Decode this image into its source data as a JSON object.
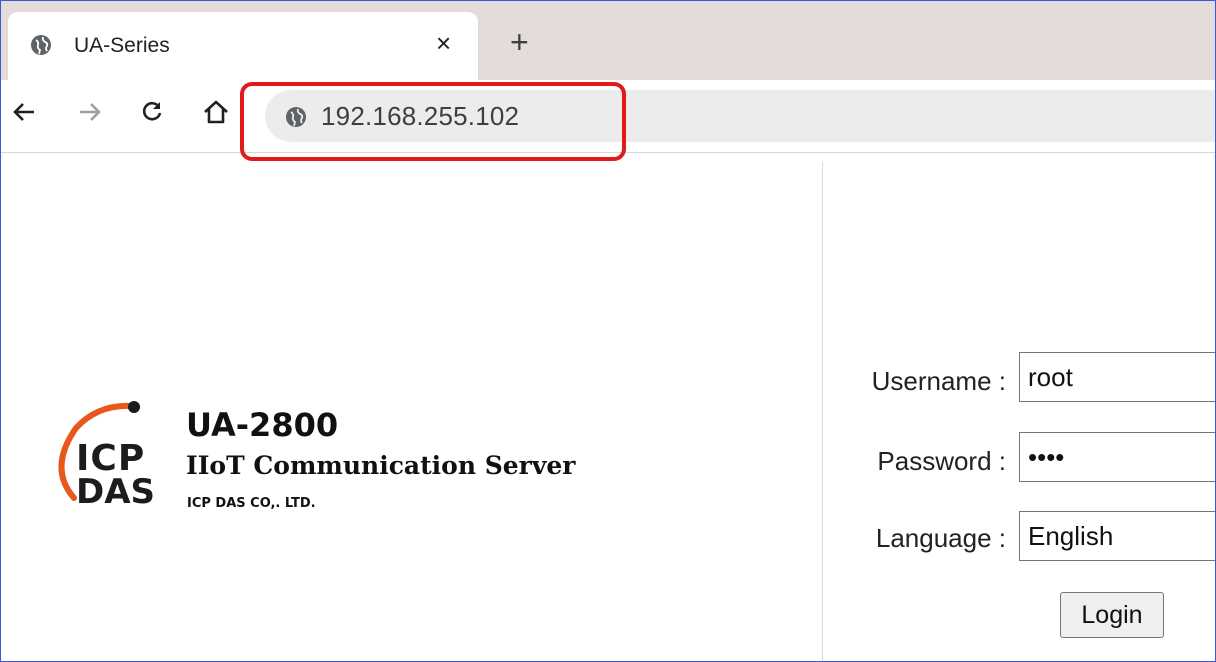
{
  "browser": {
    "tab": {
      "title": "UA-Series",
      "close_glyph": "×"
    },
    "new_tab_glyph": "+",
    "address_bar": {
      "url": "192.168.255.102"
    },
    "icons": [
      "globe-icon",
      "back-icon",
      "forward-icon",
      "reload-icon",
      "home-icon"
    ],
    "highlight_color": "#e01b1b"
  },
  "branding": {
    "logo_line1": "ICP",
    "logo_line2": "DAS",
    "product_name": "UA-2800",
    "product_subtitle": "IIoT Communication Server",
    "company": "ICP DAS CO,. LTD."
  },
  "login_form": {
    "username_label": "Username :",
    "username_value": "root",
    "password_label": "Password :",
    "password_value": "root",
    "language_label": "Language :",
    "language_value": "English",
    "login_button": "Login"
  }
}
